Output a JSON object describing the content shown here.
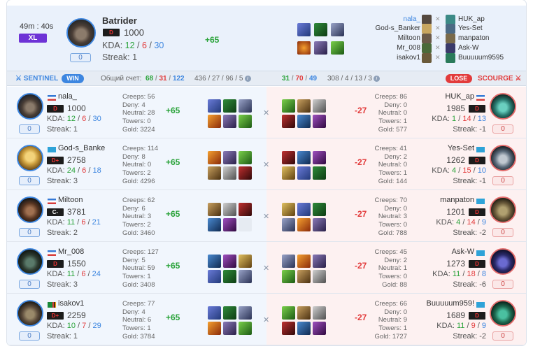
{
  "match": {
    "duration": "49m : 40s",
    "size_badge": "XL"
  },
  "featured": {
    "hero_icon": "batrider-portrait",
    "name": "Batrider",
    "rank": "D",
    "mmr": "1000",
    "kda_label": "KDA:",
    "k": "12",
    "d": "6",
    "a": "30",
    "streak": "Streak: 1",
    "party": "0",
    "delta": "+65"
  },
  "roster": [
    {
      "left": "nala_",
      "right": "HUK_ap"
    },
    {
      "left": "God-s_Banker",
      "right": "Yes-Set"
    },
    {
      "left": "Miltoon",
      "right": "manpaton"
    },
    {
      "left": "Mr_008",
      "right": "Ask-W"
    },
    {
      "left": "isakov1",
      "right": "Buuuuum9595"
    }
  ],
  "scorebar": {
    "sentinel": "SENTINEL",
    "win": "WIN",
    "total_label": "Общий счет:",
    "t_k": "68",
    "t_d": "31",
    "t_a": "122",
    "t_extra": "436 / 27 / 96 / 5",
    "o_k": "31",
    "o_d": "70",
    "o_a": "49",
    "o_extra": "308 / 4 / 13 / 3",
    "lose": "LOSE",
    "scourge": "SCOURGE"
  },
  "colors": {
    "sentinel": "#3d86e0",
    "scourge": "#e23b3b",
    "kills": "#2aa33a",
    "deaths": "#e23b3b",
    "assists": "#3d86e0"
  },
  "rows": [
    {
      "l": {
        "name": "nala_",
        "rank": "D",
        "mmr": "1000",
        "k": "12",
        "d": "6",
        "a": "30",
        "streak": "Streak: 1",
        "party": "0",
        "creeps": "Creeps: 56",
        "deny": "Deny: 4",
        "neutral": "Neutral: 28",
        "towers": "Towers: 0",
        "gold": "Gold: 3224",
        "delta": "+65"
      },
      "r": {
        "name": "HUK_ap",
        "rank": "D",
        "mmr": "1985",
        "k": "1",
        "d": "14",
        "a": "13",
        "streak": "Streak: -1",
        "party": "0",
        "creeps": "Creeps: 86",
        "deny": "Deny: 0",
        "neutral": "Neutral: 0",
        "towers": "Towers: 1",
        "gold": "Gold: 577",
        "delta": "-27"
      }
    },
    {
      "l": {
        "name": "God-s_Banke",
        "rank": "D+",
        "mmr": "2758",
        "k": "24",
        "d": "6",
        "a": "18",
        "streak": "Streak: 3",
        "party": "0",
        "creeps": "Creeps: 114",
        "deny": "Deny: 8",
        "neutral": "Neutral: 0",
        "towers": "Towers: 2",
        "gold": "Gold: 4296",
        "delta": "+65"
      },
      "r": {
        "name": "Yes-Set",
        "rank": "D",
        "mmr": "1262",
        "k": "4",
        "d": "15",
        "a": "10",
        "streak": "Streak: -1",
        "party": "0",
        "creeps": "Creeps: 41",
        "deny": "Deny: 2",
        "neutral": "Neutral: 0",
        "towers": "Towers: 1",
        "gold": "Gold: 144",
        "delta": "-27"
      }
    },
    {
      "l": {
        "name": "Miltoon",
        "rank": "C-",
        "mmr": "3781",
        "k": "11",
        "d": "6",
        "a": "21",
        "streak": "Streak: 2",
        "party": "0",
        "creeps": "Creeps: 62",
        "deny": "Deny: 6",
        "neutral": "Neutral: 3",
        "towers": "Towers: 2",
        "gold": "Gold: 3460",
        "delta": "+65"
      },
      "r": {
        "name": "manpaton",
        "rank": "D",
        "mmr": "1201",
        "k": "4",
        "d": "14",
        "a": "9",
        "streak": "Streak: -2",
        "party": "0",
        "creeps": "Creeps: 70",
        "deny": "Deny: 0",
        "neutral": "Neutral: 3",
        "towers": "Towers: 0",
        "gold": "Gold: 788",
        "delta": "-27"
      }
    },
    {
      "l": {
        "name": "Mr_008",
        "rank": "D",
        "mmr": "1550",
        "k": "11",
        "d": "6",
        "a": "24",
        "streak": "Streak: 3",
        "party": "0",
        "creeps": "Creeps: 127",
        "deny": "Deny: 5",
        "neutral": "Neutral: 59",
        "towers": "Towers: 1",
        "gold": "Gold: 3408",
        "delta": "+65"
      },
      "r": {
        "name": "Ask-W",
        "rank": "D",
        "mmr": "1273",
        "k": "11",
        "d": "18",
        "a": "8",
        "streak": "Streak: -6",
        "party": "0",
        "creeps": "Creeps: 45",
        "deny": "Deny: 2",
        "neutral": "Neutral: 1",
        "towers": "Towers: 0",
        "gold": "Gold: 88",
        "delta": "-27"
      }
    },
    {
      "l": {
        "name": "isakov1",
        "rank": "D+",
        "mmr": "2259",
        "k": "10",
        "d": "7",
        "a": "29",
        "streak": "Streak: 1",
        "party": "0",
        "creeps": "Creeps: 77",
        "deny": "Deny: 4",
        "neutral": "Neutral: 6",
        "towers": "Towers: 1",
        "gold": "Gold: 3784",
        "delta": "+65"
      },
      "r": {
        "name": "Buuuuum959!",
        "rank": "D",
        "mmr": "1689",
        "k": "11",
        "d": "9",
        "a": "9",
        "streak": "Streak: -2",
        "party": "0",
        "creeps": "Creeps: 66",
        "deny": "Deny: 0",
        "neutral": "Neutral: 9",
        "towers": "Towers: 1",
        "gold": "Gold: 1727",
        "delta": "-27"
      }
    }
  ]
}
